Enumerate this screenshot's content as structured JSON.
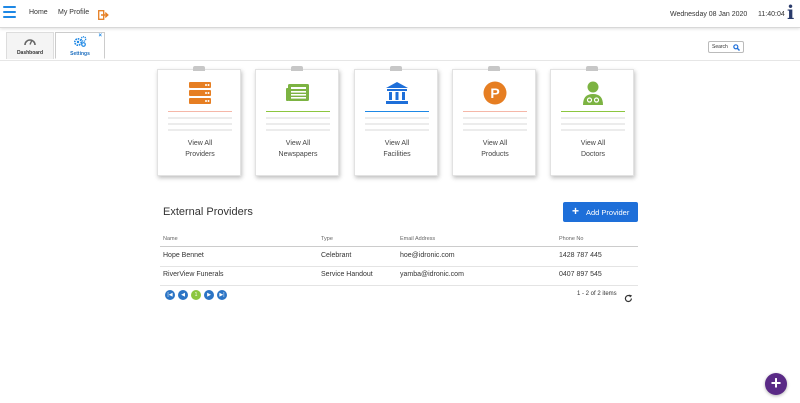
{
  "header": {
    "nav": [
      "Home",
      "My Profile"
    ],
    "date": "Wednesday 08 Jan 2020",
    "time": "11:40:04",
    "info_glyph": "i"
  },
  "tabs": [
    {
      "label": "Dashboard",
      "icon": "gauge-icon"
    },
    {
      "label": "Settings",
      "icon": "gears-icon",
      "close": "×"
    }
  ],
  "search": {
    "label": "Search"
  },
  "cards": [
    {
      "line1": "View All",
      "line2": "Providers",
      "icon": "server-icon",
      "color": "#e67e22"
    },
    {
      "line1": "View All",
      "line2": "Newspapers",
      "icon": "newspaper-icon",
      "color": "#7cb342"
    },
    {
      "line1": "View All",
      "line2": "Facilities",
      "icon": "building-icon",
      "color": "#1e88e5"
    },
    {
      "line1": "View All",
      "line2": "Products",
      "icon": "product-p-icon",
      "color": "#e67e22"
    },
    {
      "line1": "View All",
      "line2": "Doctors",
      "icon": "doctor-icon",
      "color": "#7cb342"
    }
  ],
  "section": {
    "title": "External Providers",
    "add_button": "Add Provider"
  },
  "table": {
    "columns": [
      "Name",
      "Type",
      "Email Address",
      "Phone No"
    ],
    "rows": [
      [
        "Hope Bennet",
        "Celebrant",
        "hoe@idronic.com",
        "1428 787 445"
      ],
      [
        "RiverView Funerals",
        "Service Handout",
        "yamba@idronic.com",
        "0407 897 545"
      ]
    ]
  },
  "pager": {
    "current_page": "1",
    "info": "1 - 2 of 2 items"
  },
  "fab": {
    "label": "+"
  },
  "colors": {
    "accent": "#1e6fd9",
    "fab": "#5a2a86",
    "orange": "#e67e22",
    "green": "#7cb342",
    "blue": "#1e88e5"
  }
}
